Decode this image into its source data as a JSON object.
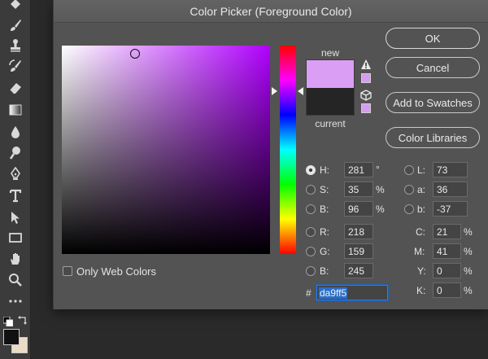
{
  "dialog": {
    "title": "Color Picker (Foreground Color)",
    "new_label": "new",
    "current_label": "current",
    "new_color": "#da9ff5",
    "current_color": "#252525",
    "only_web_colors_label": "Only Web Colors",
    "only_web_colors_checked": false
  },
  "buttons": {
    "ok": "OK",
    "cancel": "Cancel",
    "add_to_swatches": "Add to Swatches",
    "color_libraries": "Color Libraries"
  },
  "hsb": {
    "h_label": "H:",
    "h_value": "281",
    "h_unit": "°",
    "s_label": "S:",
    "s_value": "35",
    "s_unit": "%",
    "b_label": "B:",
    "b_value": "96",
    "b_unit": "%",
    "selected": "H"
  },
  "rgb": {
    "r_label": "R:",
    "r_value": "218",
    "g_label": "G:",
    "g_value": "159",
    "b_label": "B:",
    "b_value": "245"
  },
  "lab": {
    "l_label": "L:",
    "l_value": "73",
    "a_label": "a:",
    "a_value": "36",
    "b_label": "b:",
    "b_value": "-37"
  },
  "cmyk": {
    "c_label": "C:",
    "c_value": "21",
    "c_unit": "%",
    "m_label": "M:",
    "m_value": "41",
    "m_unit": "%",
    "y_label": "Y:",
    "y_value": "0",
    "y_unit": "%",
    "k_label": "K:",
    "k_value": "0",
    "k_unit": "%"
  },
  "hex": {
    "label": "#",
    "value": "da9ff5"
  },
  "toolbar": {
    "tools": [
      "paint-bucket-icon",
      "brush-icon",
      "clone-stamp-icon",
      "history-brush-icon",
      "eraser-icon",
      "gradient-icon",
      "blur-drop-icon",
      "dodge-icon",
      "pen-icon",
      "type-icon",
      "path-selection-icon",
      "rectangle-icon",
      "hand-icon",
      "zoom-icon",
      "more-icon"
    ],
    "foreground_color": "#111111",
    "background_color": "#ecdcc6"
  }
}
